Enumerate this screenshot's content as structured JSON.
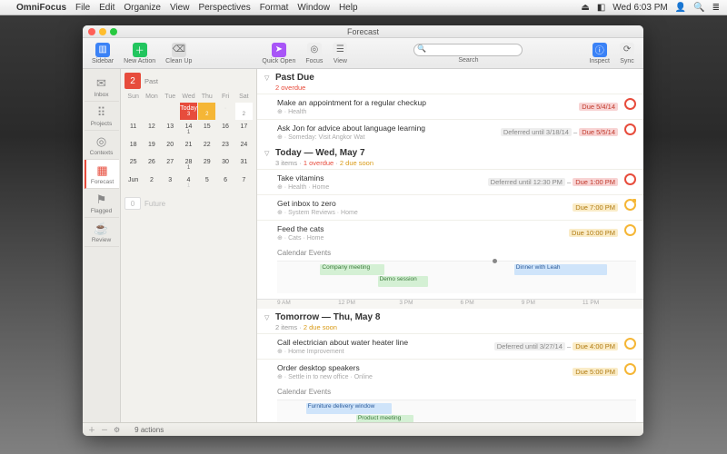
{
  "menubar": {
    "app": "OmniFocus",
    "items": [
      "File",
      "Edit",
      "Organize",
      "View",
      "Perspectives",
      "Format",
      "Window",
      "Help"
    ],
    "clock": "Wed 6:03 PM"
  },
  "window": {
    "title": "Forecast"
  },
  "toolbar": {
    "sidebar": "Sidebar",
    "new_action": "New Action",
    "clean_up": "Clean Up",
    "quick_open": "Quick Open",
    "focus": "Focus",
    "view": "View",
    "search": "Search",
    "inspect": "Inspect",
    "sync": "Sync"
  },
  "rail": {
    "inbox": "Inbox",
    "projects": "Projects",
    "contexts": "Contexts",
    "forecast": "Forecast",
    "flagged": "Flagged",
    "review": "Review"
  },
  "calendar": {
    "past_badge": "2",
    "past_label": "Past",
    "days": [
      "Sun",
      "Mon",
      "Tue",
      "Wed",
      "Thu",
      "Fri",
      "Sat"
    ],
    "today_label": "Today",
    "today_count": "3",
    "tomorrow_count": "2",
    "fri_count": "",
    "sat_num": "2",
    "future_badge": "0",
    "future_label": "Future",
    "month_end": [
      "Jun",
      "2",
      "3",
      "4",
      "5",
      "6",
      "7"
    ]
  },
  "sections": {
    "past": {
      "title": "Past Due",
      "sub_overdue": "2 overdue",
      "tasks": [
        {
          "title": "Make an appointment for a regular checkup",
          "meta": "⊕ · Health",
          "due": "Due 5/4/14",
          "due_cls": "red"
        },
        {
          "title": "Ask Jon for advice about language learning",
          "meta": "⊕ · Someday: Visit Angkor Wat",
          "deferred": "Deferred until 3/18/14",
          "due": "Due 5/5/14",
          "due_cls": "red"
        }
      ]
    },
    "today": {
      "title": "Today — Wed, May 7",
      "sub_items": "3 items",
      "sub_overdue": "1 overdue",
      "sub_soon": "2 due soon",
      "tasks": [
        {
          "title": "Take vitamins",
          "meta": "⊕ · Health · Home",
          "deferred": "Deferred until 12:30 PM",
          "due": "Due 1:00 PM",
          "due_cls": "red"
        },
        {
          "title": "Get inbox to zero",
          "meta": "⊕ · System Reviews · Home",
          "due": "Due 7:00 PM",
          "due_cls": "orange",
          "flag": true
        },
        {
          "title": "Feed the cats",
          "meta": "⊕ · Cats · Home",
          "due": "Due 10:00 PM",
          "due_cls": "orange"
        }
      ],
      "calendar_events": "Calendar Events",
      "events": [
        {
          "label": "Company meeting"
        },
        {
          "label": "Demo session"
        },
        {
          "label": "Dinner with Leah"
        }
      ]
    },
    "tomorrow": {
      "title": "Tomorrow — Thu, May 8",
      "sub_items": "2 items",
      "sub_soon": "2 due soon",
      "tasks": [
        {
          "title": "Call electrician about water heater line",
          "meta": "⊕ · Home Improvement",
          "deferred": "Deferred until 3/27/14",
          "due": "Due 4:00 PM",
          "due_cls": "orange"
        },
        {
          "title": "Order desktop speakers",
          "meta": "⊕ · Settle in to new office · Online",
          "due": "Due 5:00 PM",
          "due_cls": "orange"
        }
      ],
      "calendar_events": "Calendar Events",
      "events": [
        {
          "label": "Furniture delivery window"
        },
        {
          "label": "Product meeting"
        }
      ]
    }
  },
  "timeaxis": [
    "9 AM",
    "12 PM",
    "3 PM",
    "6 PM",
    "9 PM",
    "11 PM"
  ],
  "status": {
    "actions": "9 actions"
  }
}
